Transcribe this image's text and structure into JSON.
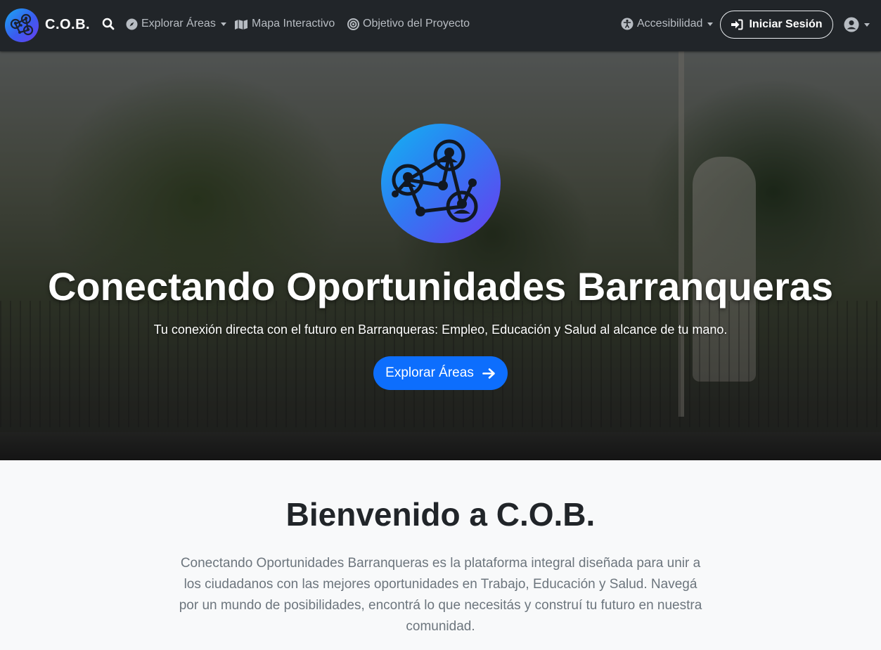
{
  "navbar": {
    "brand": "C.O.B.",
    "items": [
      {
        "label": "Explorar Áreas",
        "icon": "compass-icon",
        "dropdown": true
      },
      {
        "label": "Mapa Interactivo",
        "icon": "map-icon"
      },
      {
        "label": "Objetivo del Proyecto",
        "icon": "bullseye-icon"
      }
    ],
    "accessibility": "Accesibilidad",
    "login": "Iniciar Sesión",
    "colors": {
      "background": "#212529",
      "text": "#b7bcc2"
    }
  },
  "hero": {
    "title": "Conectando Oportunidades Barranqueras",
    "subtitle": "Tu conexión directa con el futuro en Barranqueras: Empleo, Educación y Salud al alcance de tu mano.",
    "cta": "Explorar Áreas",
    "cta_color": "#0d6efd"
  },
  "welcome": {
    "title": "Bienvenido a C.O.B.",
    "text": "Conectando Oportunidades Barranqueras es la plataforma integral diseñada para unir a los ciudadanos con las mejores oportunidades en Trabajo, Educación y Salud. Navegá por un mundo de posibilidades, encontrá lo que necesitás y construí tu futuro en nuestra comunidad."
  }
}
